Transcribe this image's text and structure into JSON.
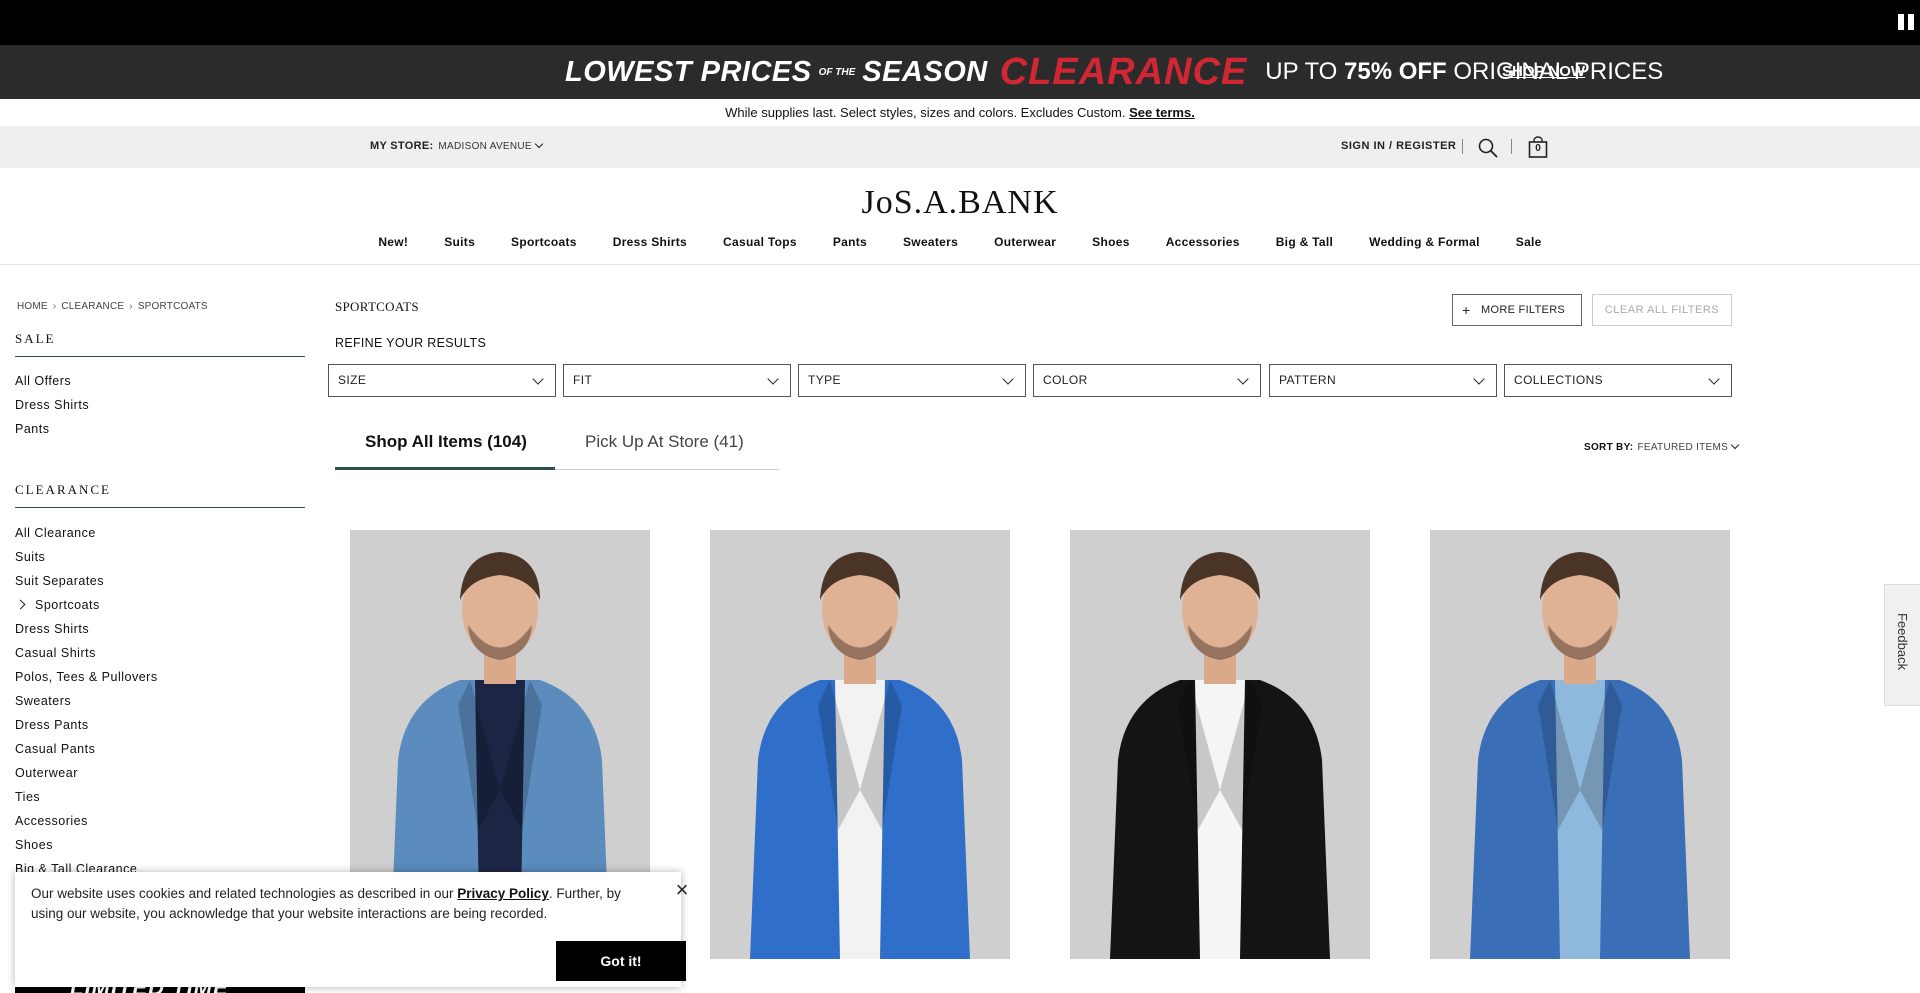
{
  "promo": {
    "lowest": "LOWEST PRICES",
    "of_the": "OF THE",
    "season": "SEASON",
    "clearance": "CLEARANCE",
    "up_to": "UP TO",
    "pct": "75% OFF",
    "original": "ORIGINAL PRICES",
    "shop_now": "SHOP NOW",
    "clearance_color": "#d12634"
  },
  "supplies": {
    "text": "While supplies last. Select styles, sizes and colors. Excludes Custom.",
    "link": "See terms."
  },
  "util": {
    "my_store_label": "MY STORE:",
    "store_name": "MADISON AVENUE",
    "sign_in": "SIGN IN / REGISTER",
    "search_icon": "search-icon",
    "cart_icon": "shopping-bag-icon",
    "cart_count": "0"
  },
  "logo": "JoS.A.BANK",
  "nav": [
    "New!",
    "Suits",
    "Sportcoats",
    "Dress Shirts",
    "Casual Tops",
    "Pants",
    "Sweaters",
    "Outerwear",
    "Shoes",
    "Accessories",
    "Big & Tall",
    "Wedding & Formal",
    "Sale"
  ],
  "breadcrumb": [
    "HOME",
    "CLEARANCE",
    "SPORTCOATS"
  ],
  "sidebar": {
    "sale_heading": "SALE",
    "sale_items": [
      "All Offers",
      "Dress Shirts",
      "Pants"
    ],
    "clearance_heading": "CLEARANCE",
    "clearance_items": [
      "All Clearance",
      "Suits",
      "Suit Separates",
      "Sportcoats",
      "Dress Shirts",
      "Casual Shirts",
      "Polos, Tees & Pullovers",
      "Sweaters",
      "Dress Pants",
      "Casual Pants",
      "Outerwear",
      "Ties",
      "Accessories",
      "Shoes",
      "Big & Tall Clearance"
    ],
    "active_item": "Sportcoats"
  },
  "main": {
    "title": "SPORTCOATS",
    "refine": "REFINE YOUR RESULTS",
    "more_filters": "MORE FILTERS",
    "clear_all": "CLEAR ALL FILTERS",
    "filters": [
      "SIZE",
      "FIT",
      "TYPE",
      "COLOR",
      "PATTERN",
      "COLLECTIONS"
    ],
    "tabs": [
      "Shop All Items (104)",
      "Pick Up At Store (41)"
    ],
    "sort_label": "SORT BY:",
    "sort_value": "FEATURED ITEMS"
  },
  "products": [
    {
      "jacket_color": "#5b8cbd",
      "shirt_color": "#1d2545"
    },
    {
      "jacket_color": "#2f6ec9",
      "shirt_color": "#f2f2f2"
    },
    {
      "jacket_color": "#141414",
      "shirt_color": "#f5f5f5"
    },
    {
      "jacket_color": "#3a6fb8",
      "shirt_color": "#8fb8dd"
    }
  ],
  "feedback": "Feedback",
  "cookie": {
    "text_before": "Our website uses cookies and related technologies as described in our",
    "link": "Privacy Policy",
    "text_after": ". Further, by using our website, you acknowledge that your website interactions are being recorded.",
    "close": "×",
    "button": "Got it!"
  },
  "left_promo": "LIMITED TIME OFFER"
}
